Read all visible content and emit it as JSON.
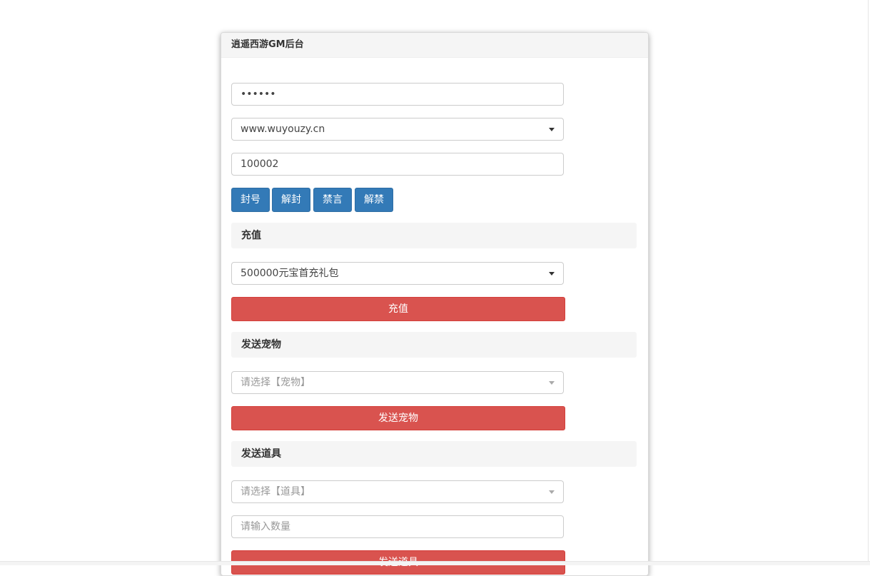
{
  "panel": {
    "title": "逍遥西游GM后台"
  },
  "login": {
    "password_value": "••••••",
    "server_selected": "www.wuyouzy.cn",
    "player_id_value": "100002"
  },
  "actions": {
    "ban_label": "封号",
    "unban_label": "解封",
    "mute_label": "禁言",
    "unmute_label": "解禁"
  },
  "recharge": {
    "section_title": "充值",
    "package_selected": "500000元宝首充礼包",
    "button_label": "充值"
  },
  "pet": {
    "section_title": "发送宠物",
    "select_placeholder": "请选择【宠物】",
    "button_label": "发送宠物"
  },
  "item": {
    "section_title": "发送道具",
    "select_placeholder": "请选择【道具】",
    "quantity_placeholder": "请输入数量",
    "button_label": "发送道具"
  }
}
